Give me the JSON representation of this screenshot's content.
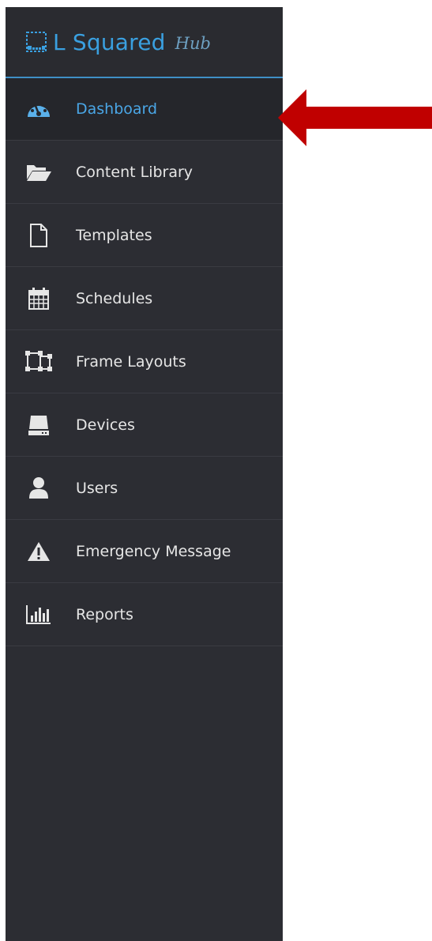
{
  "brand": {
    "name": "L Squared",
    "suffix": "Hub",
    "accent_color": "#3aa0e0"
  },
  "nav": {
    "active_index": 0,
    "items": [
      {
        "label": "Dashboard",
        "icon": "dashboard-gauge-icon"
      },
      {
        "label": "Content Library",
        "icon": "folder-open-icon"
      },
      {
        "label": "Templates",
        "icon": "document-icon"
      },
      {
        "label": "Schedules",
        "icon": "calendar-icon"
      },
      {
        "label": "Frame Layouts",
        "icon": "frame-layout-icon"
      },
      {
        "label": "Devices",
        "icon": "device-drive-icon"
      },
      {
        "label": "Users",
        "icon": "user-icon"
      },
      {
        "label": "Emergency Message",
        "icon": "warning-icon"
      },
      {
        "label": "Reports",
        "icon": "bar-chart-icon"
      }
    ]
  },
  "annotation": {
    "arrow_color": "#c00000",
    "points_to": "Dashboard"
  }
}
